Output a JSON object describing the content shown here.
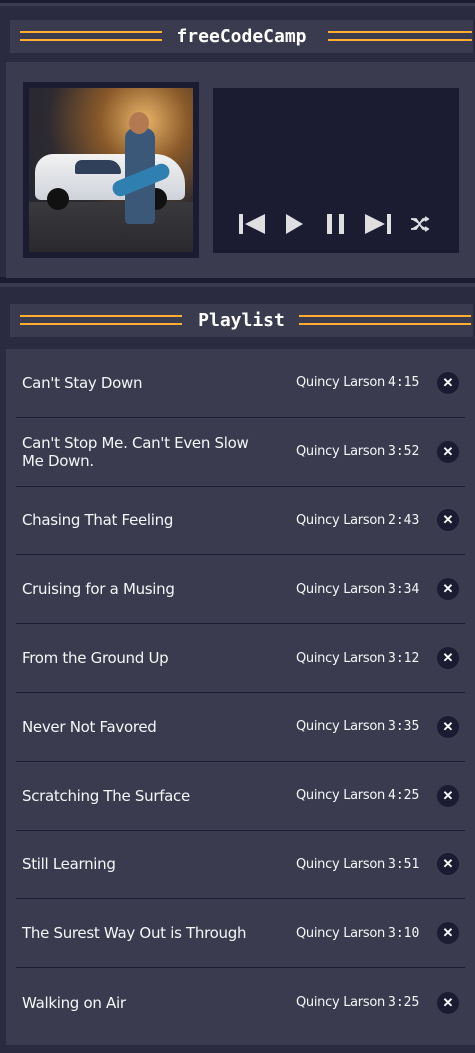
{
  "player": {
    "title": "freeCodeCamp",
    "controls": [
      {
        "name": "previous",
        "icon": "skip-previous-icon"
      },
      {
        "name": "play",
        "icon": "play-icon"
      },
      {
        "name": "pause",
        "icon": "pause-icon"
      },
      {
        "name": "next",
        "icon": "skip-next-icon"
      },
      {
        "name": "shuffle",
        "icon": "shuffle-icon"
      }
    ]
  },
  "playlist": {
    "title": "Playlist",
    "songs": [
      {
        "title": "Can't Stay Down",
        "artist": "Quincy Larson",
        "duration": "4:15"
      },
      {
        "title": "Can't Stop Me. Can't Even Slow Me Down.",
        "artist": "Quincy Larson",
        "duration": "3:52"
      },
      {
        "title": "Chasing That Feeling",
        "artist": "Quincy Larson",
        "duration": "2:43"
      },
      {
        "title": "Cruising for a Musing",
        "artist": "Quincy Larson",
        "duration": "3:34"
      },
      {
        "title": "From the Ground Up",
        "artist": "Quincy Larson",
        "duration": "3:12"
      },
      {
        "title": "Never Not Favored",
        "artist": "Quincy Larson",
        "duration": "3:35"
      },
      {
        "title": "Scratching The Surface",
        "artist": "Quincy Larson",
        "duration": "4:25"
      },
      {
        "title": "Still Learning",
        "artist": "Quincy Larson",
        "duration": "3:51"
      },
      {
        "title": "The Surest Way Out is Through",
        "artist": "Quincy Larson",
        "duration": "3:10"
      },
      {
        "title": "Walking on Air",
        "artist": "Quincy Larson",
        "duration": "3:25"
      }
    ],
    "delete_label": "✕"
  },
  "colors": {
    "accent": "#feac32",
    "background": "#1b1b32",
    "panel": "#3b3b4f",
    "text": "#f5f6f7"
  }
}
